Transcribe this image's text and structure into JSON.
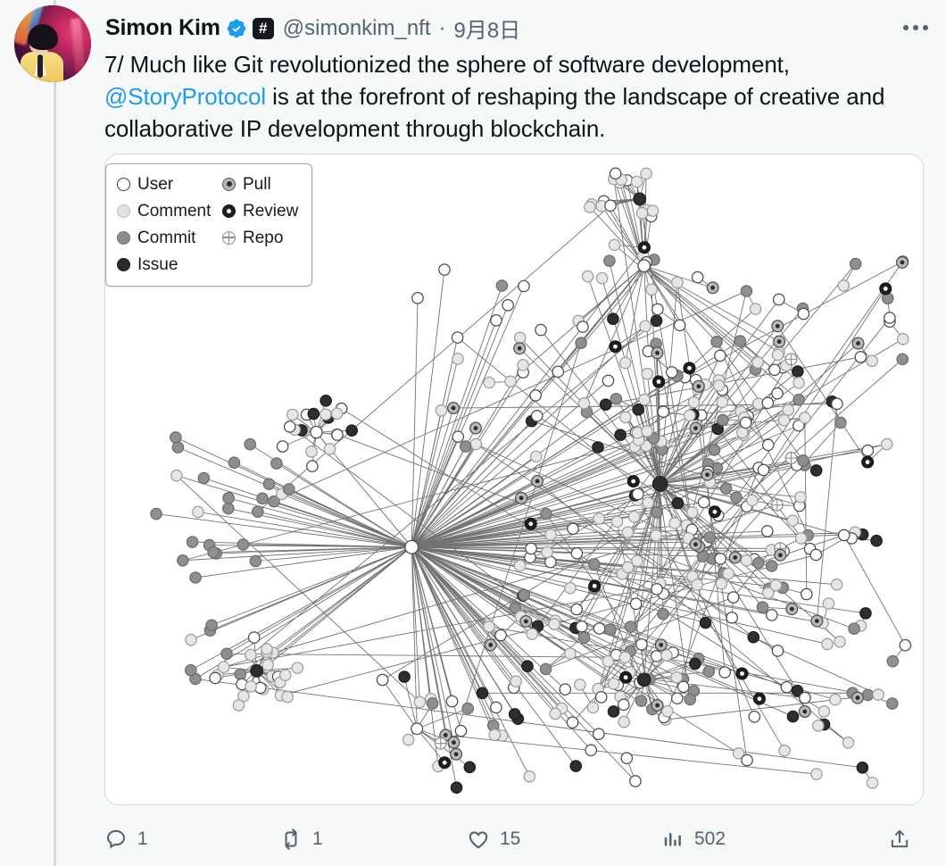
{
  "theme": {
    "page_bg": "#f7f8f8",
    "text_primary": "#0f1419",
    "text_secondary": "#536471",
    "link_blue": "#1d9bf0",
    "border": "#cfd9de",
    "card_bg": "#ffffff"
  },
  "tweet": {
    "author": {
      "display_name": "Simon Kim",
      "verified_icon": "verified-badge-icon",
      "affiliate_badge_glyph": "#",
      "handle": "@simonkim_nft"
    },
    "separator": "·",
    "timestamp": "9月8日",
    "more_icon": "more-horizontal-icon",
    "text": {
      "before_mention": "7/ Much like Git revolutionized the sphere of software development, ",
      "mention": "@StoryProtocol",
      "after_mention": " is at the forefront of reshaping the landscape of creative and collaborative IP development through blockchain."
    }
  },
  "media": {
    "alt_label": "network-graph-image",
    "legend": {
      "title": "",
      "items": [
        {
          "label": "User",
          "marker": "hollow-circle",
          "color": "#ffffff"
        },
        {
          "label": "Pull",
          "marker": "gray-dotted-circle",
          "color": "#b5b5b5"
        },
        {
          "label": "Comment",
          "marker": "light-gray-circle",
          "color": "#e3e3e3"
        },
        {
          "label": "Review",
          "marker": "dark-ringed-circle",
          "color": "#1f1f1f"
        },
        {
          "label": "Commit",
          "marker": "medium-gray-circle",
          "color": "#8c8c8c"
        },
        {
          "label": "Repo",
          "marker": "crosshair-circle",
          "color": "#ffffff"
        },
        {
          "label": "Issue",
          "marker": "black-circle",
          "color": "#2b2b2b"
        }
      ]
    }
  },
  "actions": [
    {
      "name": "reply",
      "icon": "reply-icon",
      "count": "1"
    },
    {
      "name": "retweet",
      "icon": "retweet-icon",
      "count": "1"
    },
    {
      "name": "like",
      "icon": "heart-icon",
      "count": "15"
    },
    {
      "name": "views",
      "icon": "analytics-icon",
      "count": "502"
    },
    {
      "name": "share",
      "icon": "share-icon",
      "count": ""
    }
  ]
}
